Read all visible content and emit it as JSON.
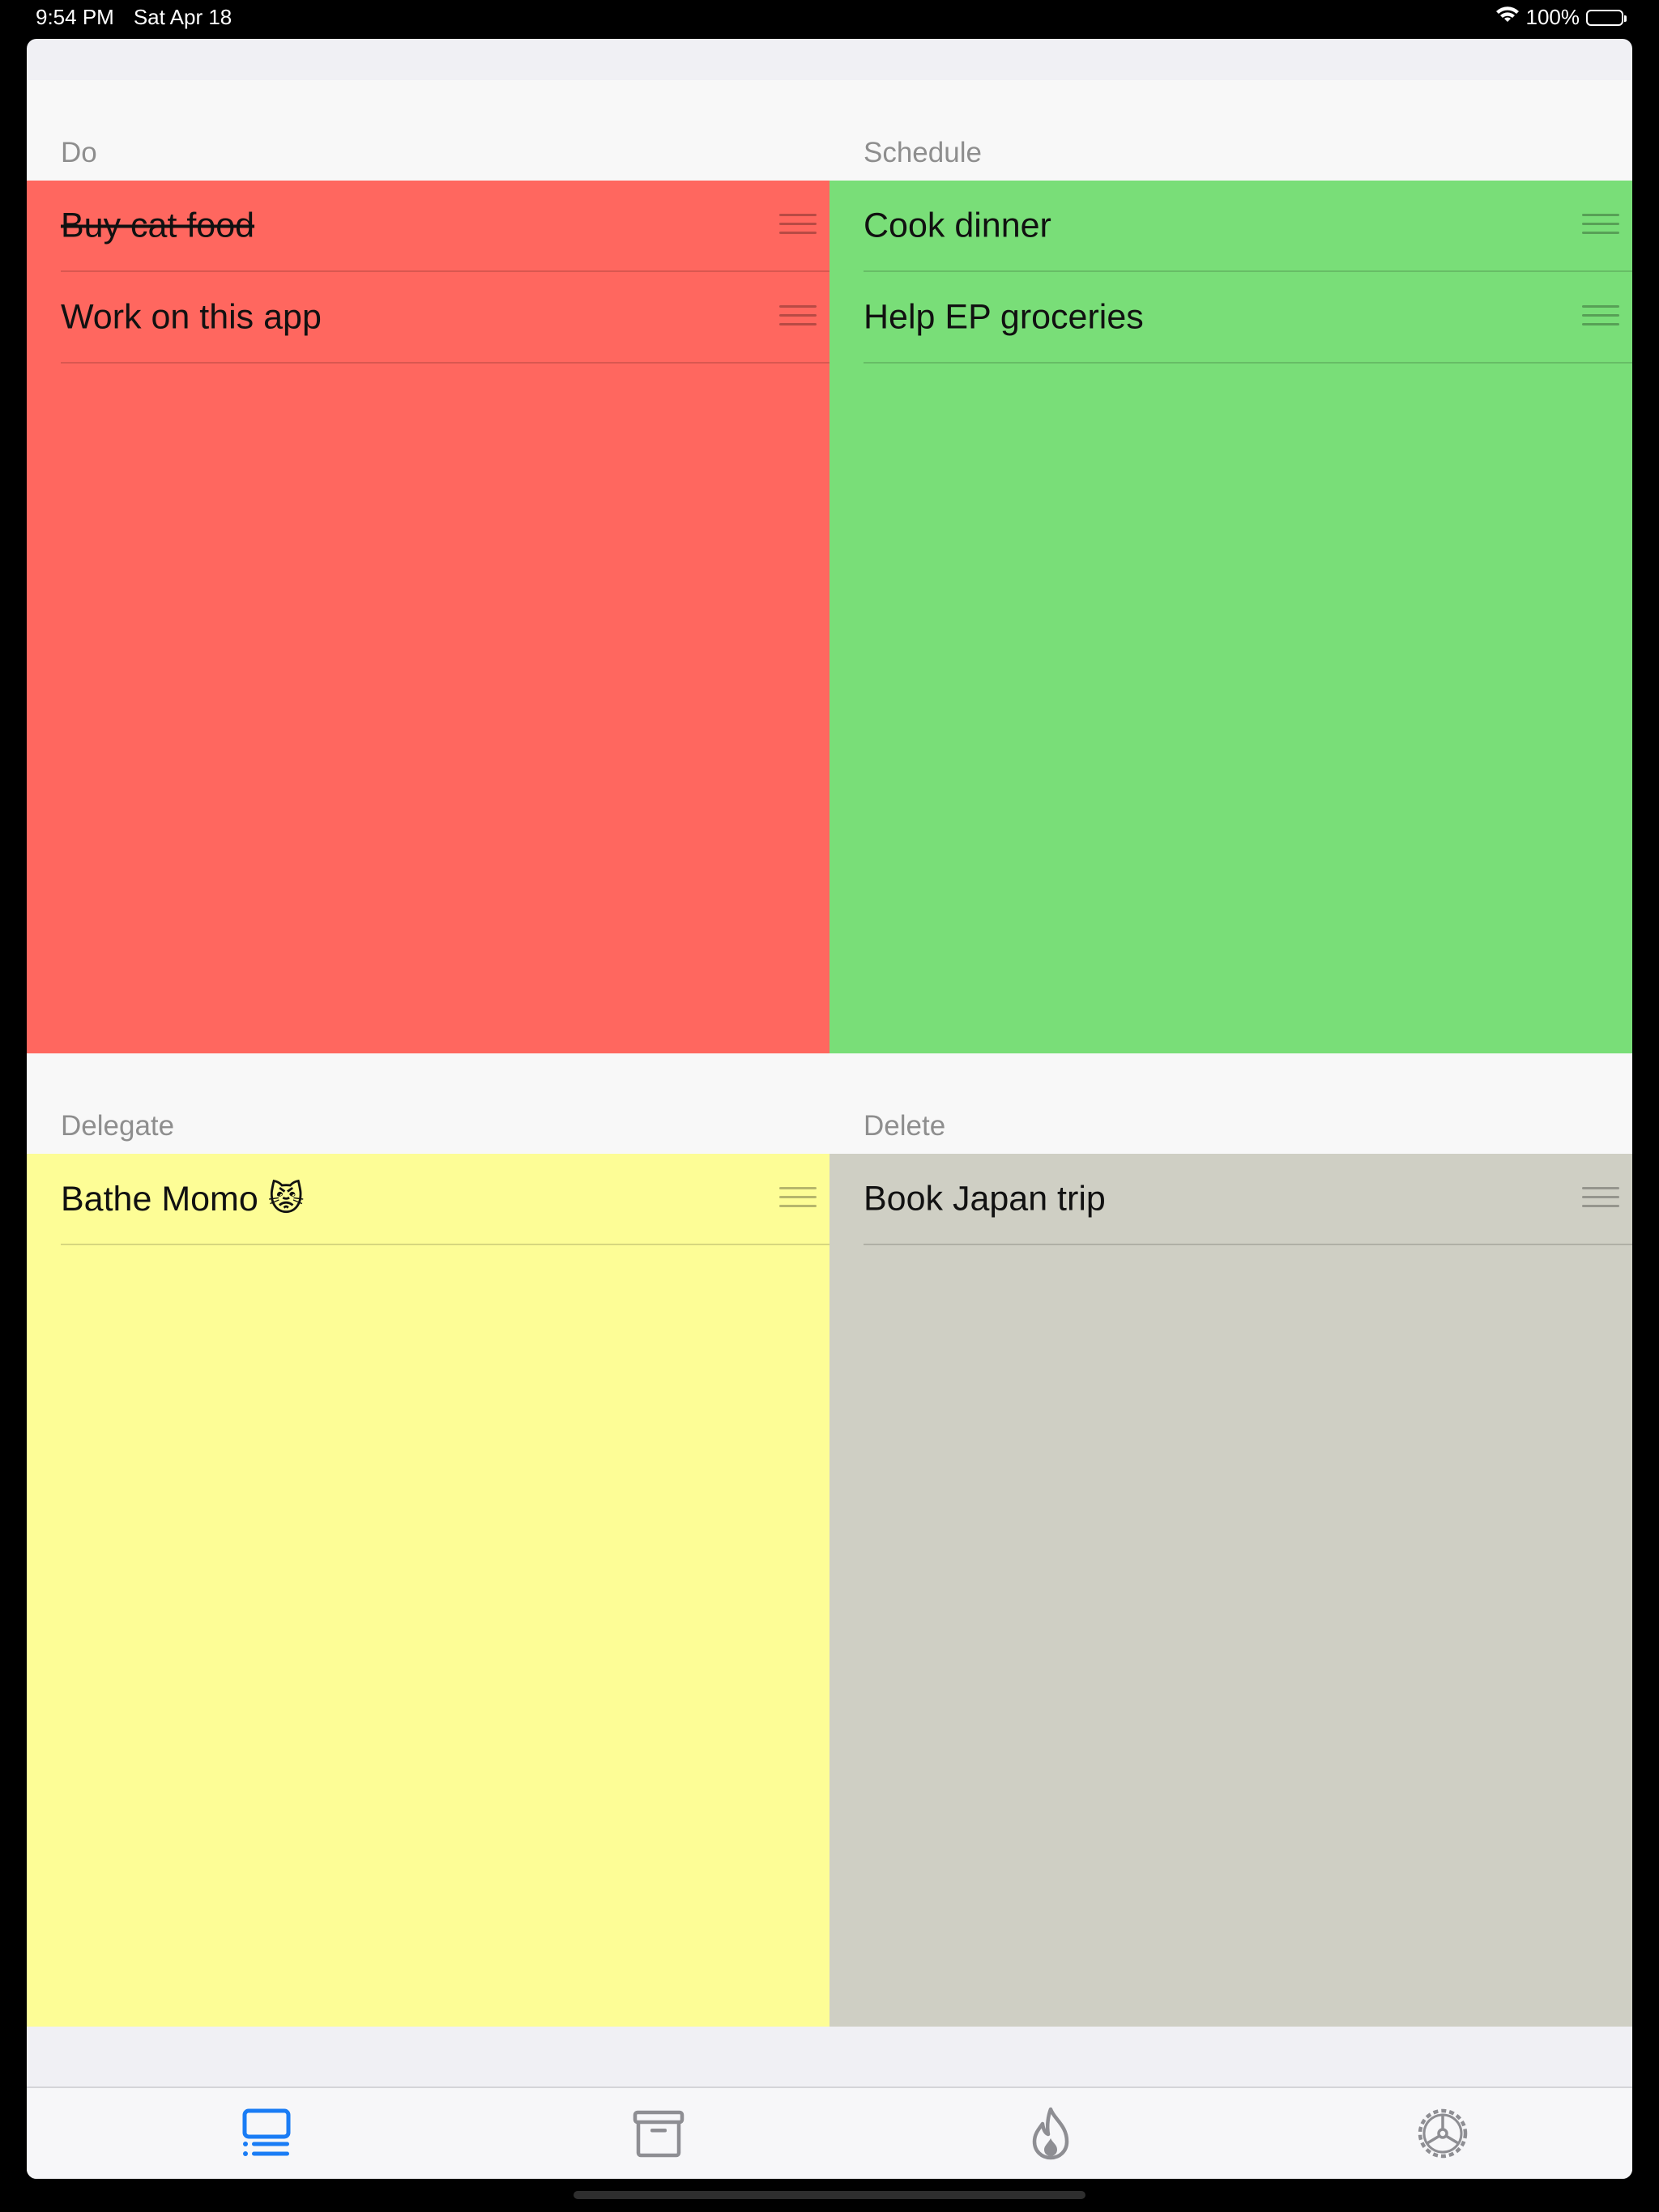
{
  "status": {
    "time": "9:54 PM",
    "date": "Sat Apr 18",
    "battery": "100%",
    "battery_level": 1.0
  },
  "quadrants": [
    {
      "title": "Do",
      "color": "#ff675f",
      "items": [
        {
          "text": "Buy cat food",
          "done": true
        },
        {
          "text": "Work on this app",
          "done": false
        }
      ]
    },
    {
      "title": "Schedule",
      "color": "#79de78",
      "items": [
        {
          "text": "Cook dinner",
          "done": false
        },
        {
          "text": "Help EP groceries",
          "done": false
        }
      ]
    },
    {
      "title": "Delegate",
      "color": "#fdfd96",
      "items": [
        {
          "text": "Bathe Momo 😾",
          "done": false
        }
      ]
    },
    {
      "title": "Delete",
      "color": "#cfcfc4",
      "items": [
        {
          "text": "Book Japan trip",
          "done": false
        }
      ]
    }
  ],
  "tabs": [
    {
      "icon": "matrix-list-icon",
      "active": true
    },
    {
      "icon": "archive-box-icon",
      "active": false
    },
    {
      "icon": "flame-icon",
      "active": false
    },
    {
      "icon": "settings-wheel-icon",
      "active": false
    }
  ],
  "colors": {
    "accent": "#1a7cf5",
    "inactive_icon": "#8e8e93"
  }
}
